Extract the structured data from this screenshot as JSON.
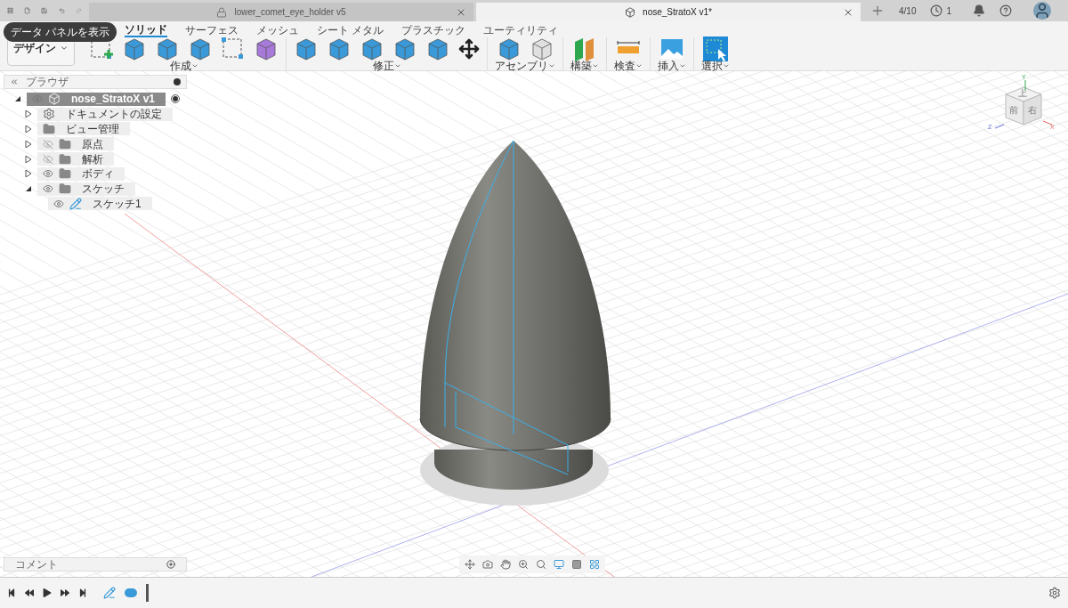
{
  "app_bar": {
    "counter": "4/10",
    "jobs": "1"
  },
  "tabs": [
    {
      "label": "lower_comet_eye_holder v5",
      "selected": false
    },
    {
      "label": "nose_StratoX v1*",
      "selected": true
    }
  ],
  "tooltip": "データ パネルを表示",
  "workspace": "デザイン",
  "toolbar_tabs": [
    {
      "label": "ソリッド",
      "selected": true
    },
    {
      "label": "サーフェス",
      "selected": false
    },
    {
      "label": "メッシュ",
      "selected": false
    },
    {
      "label": "シート メタル",
      "selected": false
    },
    {
      "label": "プラスチック",
      "selected": false
    },
    {
      "label": "ユーティリティ",
      "selected": false
    }
  ],
  "tool_groups": [
    {
      "label": "作成",
      "tools": [
        {
          "kind": "sketch"
        },
        {
          "kind": "solid"
        },
        {
          "kind": "solid"
        },
        {
          "kind": "solid"
        },
        {
          "kind": "pattern"
        },
        {
          "kind": "form"
        }
      ]
    },
    {
      "label": "修正",
      "tools": [
        {
          "kind": "solid"
        },
        {
          "kind": "solid"
        },
        {
          "kind": "solid"
        },
        {
          "kind": "solid"
        },
        {
          "kind": "solid"
        },
        {
          "kind": "move"
        }
      ]
    },
    {
      "label": "アセンブリ",
      "tools": [
        {
          "kind": "solid"
        },
        {
          "kind": "joint"
        }
      ]
    },
    {
      "label": "構築",
      "tools": [
        {
          "kind": "plane"
        }
      ]
    },
    {
      "label": "検査",
      "tools": [
        {
          "kind": "measure"
        }
      ]
    },
    {
      "label": "挿入",
      "tools": [
        {
          "kind": "image"
        }
      ]
    },
    {
      "label": "選択",
      "tools": [
        {
          "kind": "select"
        }
      ]
    }
  ],
  "browser": {
    "title": "ブラウザ",
    "tree": [
      {
        "label": "nose_StratoX v1",
        "kind": "component",
        "active": true,
        "expanded": true,
        "visible": true,
        "children": [
          {
            "label": "ドキュメントの設定",
            "kind": "gear",
            "active": false,
            "expanded": false
          },
          {
            "label": "ビュー管理",
            "kind": "folder",
            "active": false,
            "expanded": false
          },
          {
            "label": "原点",
            "kind": "folder",
            "active": false,
            "expanded": false,
            "visible": false
          },
          {
            "label": "解析",
            "kind": "folder",
            "active": false,
            "expanded": false,
            "visible": false
          },
          {
            "label": "ボディ",
            "kind": "folder",
            "active": false,
            "expanded": false,
            "visible": true
          },
          {
            "label": "スケッチ",
            "kind": "folder",
            "active": false,
            "expanded": true,
            "visible": true,
            "children": [
              {
                "label": "スケッチ1",
                "kind": "sketch",
                "active": false,
                "visible": true
              }
            ]
          }
        ]
      }
    ]
  },
  "view_cube": {
    "faces": [
      "上",
      "前",
      "右"
    ],
    "axes": [
      "Y",
      "Z",
      "X"
    ]
  },
  "comments": {
    "title": "コメント"
  }
}
